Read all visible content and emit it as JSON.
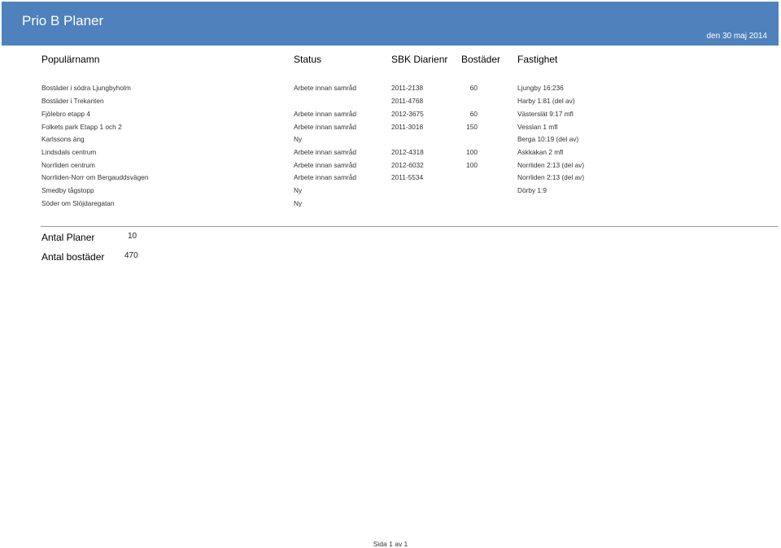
{
  "header": {
    "title": "Prio B Planer",
    "date": "den 30 maj 2014",
    "bg_color": "#4f81bd"
  },
  "columns": {
    "name": "Populärnamn",
    "status": "Status",
    "diarienr": "SBK Diarienr",
    "bostader": "Bostäder",
    "fastighet": "Fastighet"
  },
  "rows": [
    {
      "name": "Bostäder i södra Ljungbyholm",
      "status": "Arbete innan samråd",
      "diarienr": "2011-2138",
      "bostader": "60",
      "fastighet": "Ljungby 16:236"
    },
    {
      "name": "Bostäder i Trekanten",
      "status": "",
      "diarienr": "2011-4768",
      "bostader": "",
      "fastighet": "Harby 1:81 (del av)"
    },
    {
      "name": "Fjölebro etapp 4",
      "status": "Arbete innan samråd",
      "diarienr": "2012-3675",
      "bostader": "60",
      "fastighet": "Västerslät 9:17 mfl"
    },
    {
      "name": "Folkets park Etapp 1 och 2",
      "status": "Arbete innan samråd",
      "diarienr": "2011-3018",
      "bostader": "150",
      "fastighet": "Vesslan 1 mfl"
    },
    {
      "name": "Karlssons äng",
      "status": "Ny",
      "diarienr": "",
      "bostader": "",
      "fastighet": "Berga 10:19 (del av)"
    },
    {
      "name": "Lindsdals centrum",
      "status": "Arbete innan samråd",
      "diarienr": "2012-4318",
      "bostader": "100",
      "fastighet": "Askkakan 2 mfl"
    },
    {
      "name": "Norrliden centrum",
      "status": "Arbete innan samråd",
      "diarienr": "2012-6032",
      "bostader": "100",
      "fastighet": "Norrliden 2:13 (del av)"
    },
    {
      "name": "Norrliden-Norr om Bergauddsvägen",
      "status": "Arbete innan samråd",
      "diarienr": "2011-5534",
      "bostader": "",
      "fastighet": "Norrliden 2:13 (del av)"
    },
    {
      "name": "Smedby tågstopp",
      "status": "Ny",
      "diarienr": "",
      "bostader": "",
      "fastighet": "Dörby 1:9"
    },
    {
      "name": "Söder om Slöjdaregatan",
      "status": "Ny",
      "diarienr": "",
      "bostader": "",
      "fastighet": ""
    }
  ],
  "summary": {
    "planer_label": "Antal Planer",
    "planer_value": "10",
    "bostader_label": "Antal bostäder",
    "bostader_value": "470"
  },
  "footer": {
    "page": "Sida 1 av 1"
  }
}
